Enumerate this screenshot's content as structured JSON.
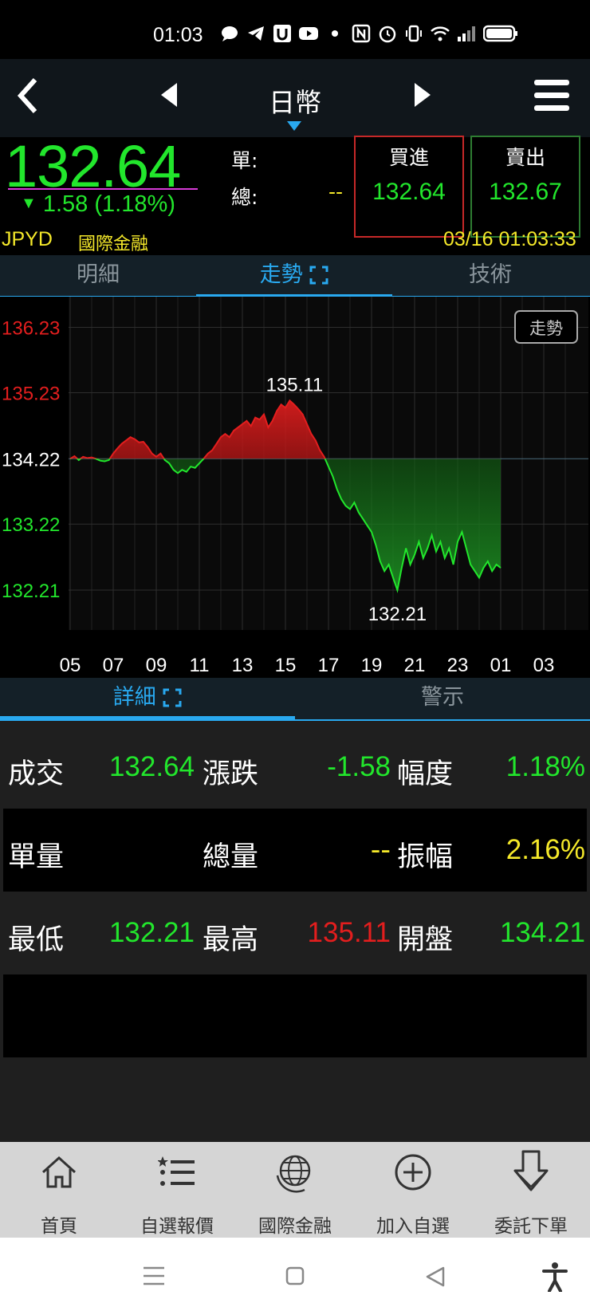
{
  "status": {
    "time": "01:03"
  },
  "nav": {
    "title": "日幣"
  },
  "quote": {
    "last": "132.64",
    "change_arrow": "▼",
    "change": "1.58 (1.18%)",
    "unit_label": "單:",
    "total_label": "總:",
    "total_value": "--",
    "buy_label": "買進",
    "buy_price": "132.64",
    "sell_label": "賣出",
    "sell_price": "132.67",
    "symbol": "JPYD",
    "market": "國際金融",
    "datetime": "03/16 01:03:33"
  },
  "tabs": [
    {
      "label": "明細"
    },
    {
      "label": "走勢"
    },
    {
      "label": "技術"
    }
  ],
  "chart_badge": "走勢",
  "chart_data": {
    "type": "area",
    "ylim": [
      131.6,
      136.7
    ],
    "yticks": [
      136.23,
      135.23,
      134.22,
      133.22,
      132.21
    ],
    "ytick_labels": [
      "136.23",
      "135.23",
      "134.22",
      "133.22",
      "132.21"
    ],
    "reference": 134.22,
    "high_label": "135.11",
    "low_label": "132.21",
    "xticks": [
      "05",
      "07",
      "09",
      "11",
      "13",
      "15",
      "17",
      "19",
      "21",
      "23",
      "01",
      "03"
    ],
    "x": [
      0,
      2,
      4,
      6,
      8,
      10,
      12,
      14,
      16,
      18,
      20,
      22,
      24,
      26,
      28,
      30,
      32,
      34,
      36,
      38,
      40,
      42,
      44,
      46,
      48,
      50,
      52,
      54,
      56,
      58,
      60,
      62,
      64,
      66,
      68,
      70,
      72,
      74,
      76,
      78,
      80,
      82,
      84,
      86,
      88,
      90,
      92,
      94,
      96,
      98,
      100,
      102,
      104,
      106,
      108,
      110,
      112,
      114,
      116,
      118,
      120,
      122,
      124,
      126,
      128,
      130,
      132,
      134,
      136,
      138,
      140,
      142,
      144,
      146,
      148,
      150,
      152,
      154,
      156,
      158,
      160,
      162,
      164,
      166,
      168,
      170,
      172,
      174,
      176,
      178,
      180,
      182,
      184,
      186,
      188,
      190,
      192,
      194,
      196,
      198,
      200
    ],
    "values": [
      134.22,
      134.26,
      134.2,
      134.25,
      134.23,
      134.24,
      134.22,
      134.19,
      134.18,
      134.2,
      134.3,
      134.38,
      134.45,
      134.5,
      134.55,
      134.52,
      134.47,
      134.48,
      134.4,
      134.3,
      134.25,
      134.3,
      134.2,
      134.15,
      134.05,
      134.0,
      134.05,
      134.02,
      134.1,
      134.08,
      134.15,
      134.22,
      134.3,
      134.35,
      134.45,
      134.55,
      134.6,
      134.55,
      134.65,
      134.7,
      134.75,
      134.8,
      134.72,
      134.85,
      134.82,
      134.9,
      134.7,
      134.8,
      134.95,
      135.05,
      135.0,
      135.11,
      135.05,
      134.98,
      134.9,
      134.75,
      134.6,
      134.5,
      134.35,
      134.25,
      134.1,
      133.95,
      133.75,
      133.6,
      133.5,
      133.45,
      133.55,
      133.4,
      133.3,
      133.2,
      133.1,
      132.9,
      132.65,
      132.5,
      132.6,
      132.4,
      132.21,
      132.55,
      132.85,
      132.6,
      132.75,
      132.95,
      132.7,
      132.85,
      133.05,
      132.8,
      132.95,
      132.7,
      132.85,
      132.6,
      132.95,
      133.1,
      132.85,
      132.6,
      132.5,
      132.4,
      132.55,
      132.65,
      132.5,
      132.6,
      132.55
    ]
  },
  "tabs2": [
    {
      "label": "詳細"
    },
    {
      "label": "警示"
    }
  ],
  "details": [
    [
      {
        "label": "成交",
        "value": "132.64"
      },
      {
        "label": "漲跌",
        "value": "-1.58"
      },
      {
        "label": "幅度",
        "value": "1.18%"
      }
    ],
    [
      {
        "label": "單量",
        "value": ""
      },
      {
        "label": "總量",
        "value": "--"
      },
      {
        "label": "振幅",
        "value": "2.16%"
      }
    ],
    [
      {
        "label": "最低",
        "value": "132.21"
      },
      {
        "label": "最高",
        "value": "135.11"
      },
      {
        "label": "開盤",
        "value": "134.21"
      }
    ]
  ],
  "colors": {
    "up": "#e31e1e",
    "down": "#22e62c",
    "neutral": "#ffffff",
    "warn": "#f5e92a",
    "accent": "#29a9f0"
  },
  "bottom_nav": [
    {
      "label": "首頁",
      "icon": "home-icon"
    },
    {
      "label": "自選報價",
      "icon": "watchlist-icon"
    },
    {
      "label": "國際金融",
      "icon": "globe-icon"
    },
    {
      "label": "加入自選",
      "icon": "add-circle-icon"
    },
    {
      "label": "委託下單",
      "icon": "order-arrow-icon"
    }
  ]
}
